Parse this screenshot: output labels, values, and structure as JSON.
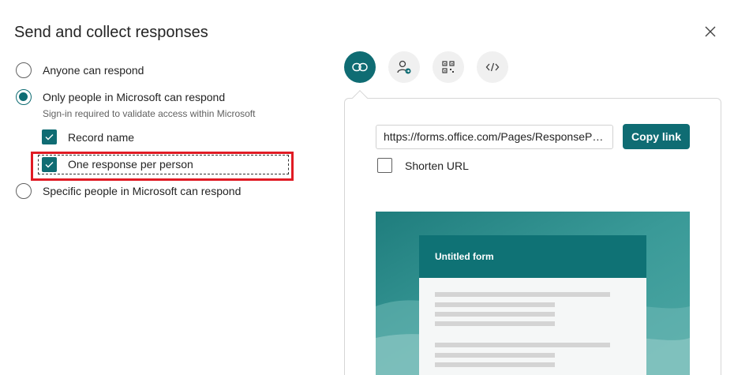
{
  "dialog": {
    "title": "Send and collect responses"
  },
  "options": {
    "anyone": "Anyone can respond",
    "org": "Only people in Microsoft can respond",
    "org_sub": "Sign-in required to validate access within Microsoft",
    "record_name": "Record name",
    "one_response": "One response per person",
    "specific": "Specific people in Microsoft can respond",
    "selected": "org"
  },
  "tabs": [
    {
      "icon": "link-icon",
      "active": true
    },
    {
      "icon": "person-share-icon",
      "active": false
    },
    {
      "icon": "qr-code-icon",
      "active": false
    },
    {
      "icon": "embed-code-icon",
      "active": false
    }
  ],
  "share": {
    "url": "https://forms.office.com/Pages/ResponsePag...",
    "copy_label": "Copy link",
    "shorten_label": "Shorten URL"
  },
  "preview": {
    "form_title": "Untitled form"
  },
  "colors": {
    "accent": "#0f6c73",
    "highlight": "#e01b24"
  }
}
